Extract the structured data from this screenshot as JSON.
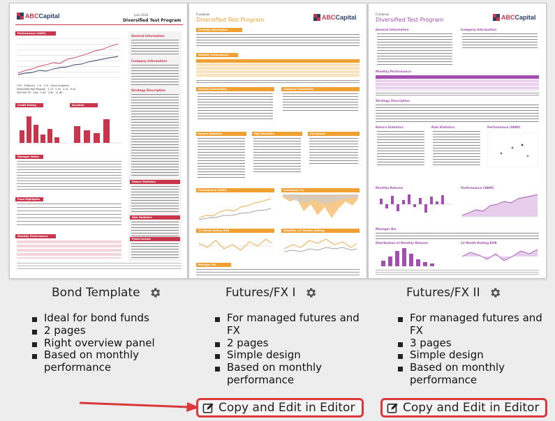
{
  "templates": [
    {
      "title": "Bond Template",
      "features": [
        "Ideal for bond funds",
        "2 pages",
        "Right overview panel",
        "Based on monthly performance"
      ],
      "preview": {
        "logo_brand": "ABC",
        "logo_rest": "Capital",
        "date": "June 2016",
        "doc_title": "Diversified Test Program",
        "sections": [
          "Performance (VAMI)",
          "General Information",
          "Company Information",
          "Strategy Description",
          "Credit Rating",
          "Duration",
          "Manager Notes",
          "Return Statistics",
          "Fund Highlights",
          "Risk Statistics",
          "Monthly Performance",
          "Fixed Income"
        ]
      }
    },
    {
      "title": "Futures/FX I",
      "features": [
        "For managed futures and FX",
        "2 pages",
        "Simple design",
        "Based on monthly performance"
      ],
      "copy_label": "Copy and Edit in Editor",
      "preview": {
        "logo_brand": "ABC",
        "logo_rest": "Capital",
        "kicker": "Fundpeak",
        "doc_title": "Diversified Test Program",
        "sections": [
          "Strategy Description",
          "Monthly Performance",
          "General Information",
          "Company Information",
          "Return Statistics",
          "Risk Statistics",
          "Correlation",
          "Performance (VAMI)",
          "Drawdown (%)",
          "12 Month Rolling ROR",
          "Volatility (12 Months Rolling)",
          "Manager Bio"
        ]
      }
    },
    {
      "title": "Futures/FX II",
      "features": [
        "For managed futures and FX",
        "3 pages",
        "Simple design",
        "Based on monthly performance"
      ],
      "copy_label": "Copy and Edit in Editor",
      "preview": {
        "logo_brand": "ABC",
        "logo_rest": "Capital",
        "kicker": "Fundpeak",
        "doc_title": "Diversified Test Program",
        "sections": [
          "General Information",
          "Company Information",
          "Monthly Performance",
          "Strategy Description",
          "Return Statistics",
          "Risk Statistics",
          "Performance (VAMI)",
          "Drawdown (%)",
          "Monthly Returns",
          "Performance (VAMI)",
          "Manager Bio",
          "Distribution of Monthly Returns",
          "12 Month Rolling ROR"
        ]
      }
    }
  ],
  "colors": {
    "bond_accent": "#c9354a",
    "fx1_accent": "#f0a030",
    "fx2_accent": "#a24fb0",
    "highlight_red": "#d9393b",
    "navy": "#2b3f6b"
  },
  "icons": {
    "settings": "gear-icon",
    "edit": "edit-icon",
    "arrow": "arrow-right-icon"
  }
}
